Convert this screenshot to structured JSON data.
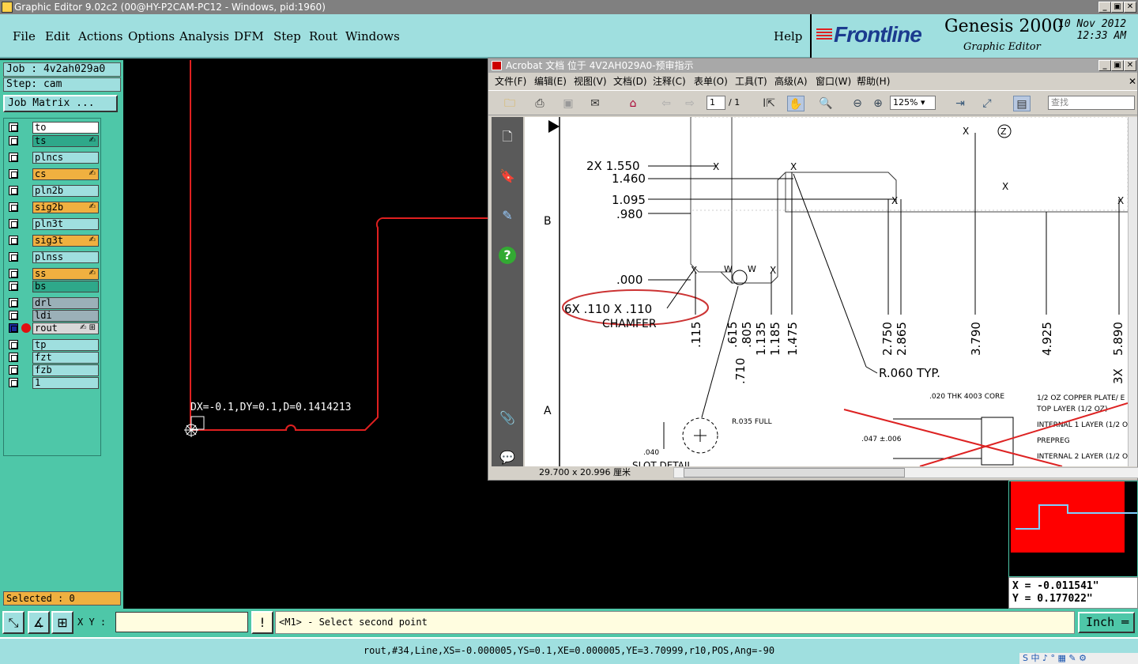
{
  "window": {
    "title": "Graphic Editor 9.02c2 (00@HY-P2CAM-PC12 - Windows, pid:1960)",
    "min_label": "_",
    "max_label": "▣",
    "close_label": "✕"
  },
  "menubar": {
    "items": [
      "File",
      "Edit",
      "Actions",
      "Options",
      "Analysis",
      "DFM",
      "Step",
      "Rout",
      "Windows"
    ],
    "help": "Help"
  },
  "brand": {
    "logo": "Frontline",
    "product": "Genesis 2000",
    "subtitle": "Graphic Editor",
    "date": "10 Nov 2012",
    "time": "12:33 AM"
  },
  "job": {
    "job_label": "Job : 4v2ah029a0",
    "step_label": "Step: cam",
    "matrix_button": "Job Matrix ..."
  },
  "layers": [
    {
      "name": "to",
      "color": "#ffffff"
    },
    {
      "name": "ts",
      "color": "#2ea88a",
      "mark": "✍"
    },
    {
      "name": "plncs",
      "color": "#9fdfdf"
    },
    {
      "name": "cs",
      "color": "#f0b040",
      "mark": "✍"
    },
    {
      "name": "pln2b",
      "color": "#9fdfdf"
    },
    {
      "name": "sig2b",
      "color": "#f0b040",
      "mark": "✍"
    },
    {
      "name": "pln3t",
      "color": "#9fdfdf"
    },
    {
      "name": "sig3t",
      "color": "#f0b040",
      "mark": "✍"
    },
    {
      "name": "plnss",
      "color": "#9fdfdf"
    },
    {
      "name": "ss",
      "color": "#f0b040",
      "mark": "✍"
    },
    {
      "name": "bs",
      "color": "#2ea88a"
    },
    {
      "name": "drl",
      "color": "#9bb0b8"
    },
    {
      "name": "ldi",
      "color": "#9bb0b8"
    },
    {
      "name": "rout",
      "color": "#d8d8d8",
      "mark": "✍ ⊞",
      "active": true
    },
    {
      "name": "tp",
      "color": "#9fdfdf"
    },
    {
      "name": "fzt",
      "color": "#9fdfdf"
    },
    {
      "name": "fzb",
      "color": "#9fdfdf"
    },
    {
      "name": "1",
      "color": "#9fdfdf"
    }
  ],
  "selected_label": "Selected : 0",
  "graphic": {
    "measure_label": "DX=-0.1,DY=0.1,D=0.1414213",
    "profile_color": "#e02020"
  },
  "acrobat": {
    "title": "Acrobat 文档 位于 4V2AH029A0-预审指示",
    "menus": [
      "文件(F)",
      "编辑(E)",
      "视图(V)",
      "文档(D)",
      "注释(C)",
      "表单(O)",
      "工具(T)",
      "高级(A)",
      "窗口(W)",
      "帮助(H)"
    ],
    "page_value": "1",
    "page_total": "/ 1",
    "zoom": "125%",
    "search_placeholder": "查找",
    "page_size": "29.700 x 20.996 厘米",
    "drawing": {
      "dims_left": [
        "2X 1.550",
        "1.460",
        "1.095",
        ".980",
        ".000"
      ],
      "chamfer_note": "6X .110 X .110",
      "chamfer_word": "CHAMFER",
      "row_b": "B",
      "row_a": "A",
      "x_dims": [
        ".115",
        ".615",
        ".710",
        ".805",
        "1.135",
        "1.185",
        "1.475",
        "2.750",
        "2.865",
        "3.790",
        "4.925",
        "5.890",
        "3X"
      ],
      "radius_note": "R.060 TYP.",
      "slot_note": "R.035 FULL",
      "slot_dim": ".040",
      "slot_detail": "SLOT DETAIL",
      "stack_core": ".020 THK 4003 CORE",
      "stack_thk": ".047 ±.006",
      "stack_layers": [
        "1/2 OZ COPPER PLATE/ E",
        "TOP LAYER (1/2 OZ)",
        "INTERNAL 1 LAYER (1/2 O",
        "PREPREG",
        "INTERNAL 2 LAYER (1/2 O"
      ],
      "w_label": "W",
      "x_label": "X",
      "z_label": "Z"
    }
  },
  "coords": {
    "x": "X = -0.011541\"",
    "y": "Y = 0.177022\""
  },
  "bottom": {
    "xy_label": "X Y :",
    "xy_value": "",
    "prompt": "<M1> - Select second point",
    "unit": "Inch ═"
  },
  "status_line": "rout,#34,Line,XS=-0.000005,YS=0.1,XE=0.000005,YE=3.70999,r10,POS,Ang=-90",
  "tray": "S 中 ♪ ° ▦ ✎ ⚙"
}
